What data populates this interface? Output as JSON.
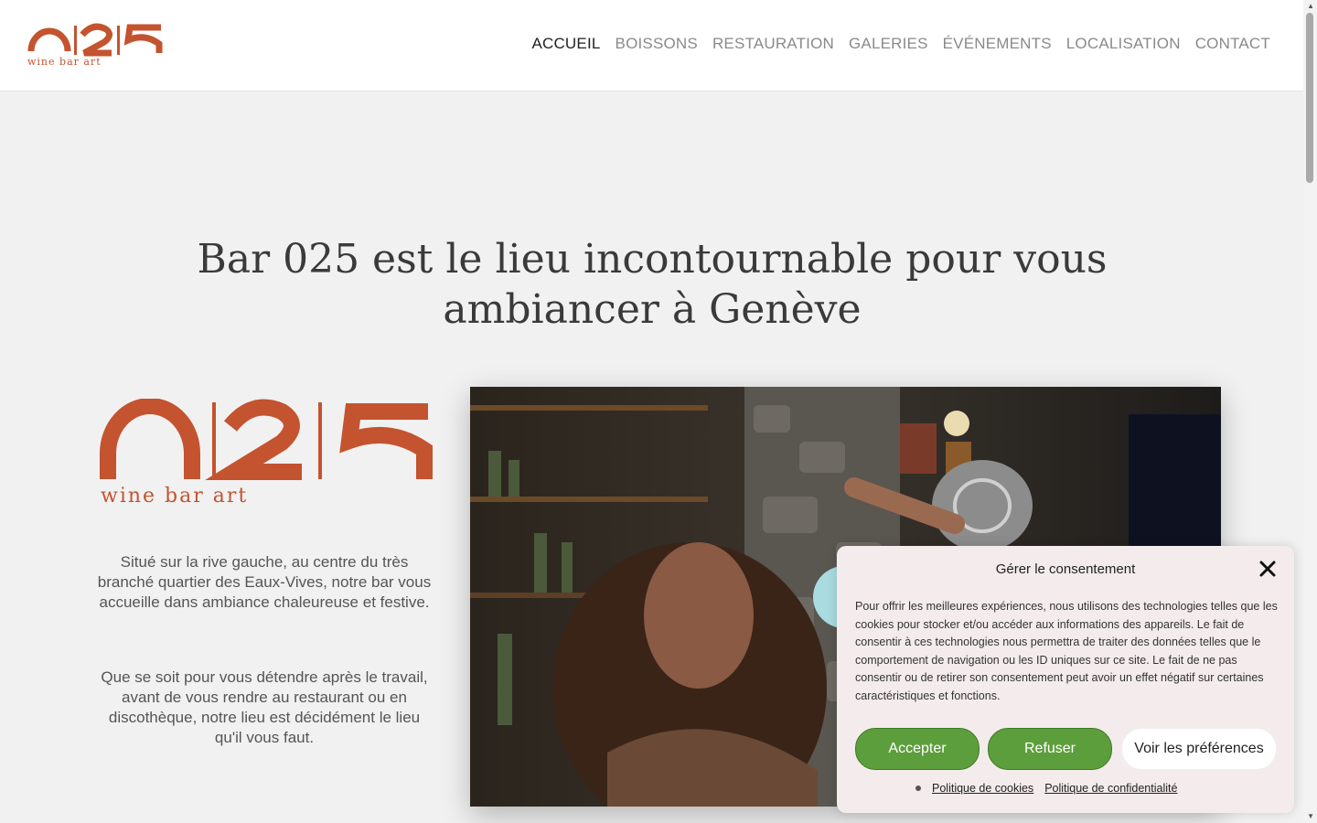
{
  "header": {
    "logo_caption": "wine bar art",
    "nav": [
      {
        "label": "ACCUEIL",
        "active": true
      },
      {
        "label": "BOISSONS"
      },
      {
        "label": "RESTAURATION"
      },
      {
        "label": "GALERIES"
      },
      {
        "label": "ÉVÉNEMENTS"
      },
      {
        "label": "LOCALISATION"
      },
      {
        "label": "CONTACT"
      }
    ]
  },
  "hero": {
    "title": "Bar 025 est le lieu incontournable pour vous ambiancer à Genève"
  },
  "intro": {
    "logo_caption": "wine bar art",
    "paragraph_1": "Situé sur la rive gauche, au centre du très branché quartier des Eaux-Vives, notre bar vous accueille dans ambiance chaleureuse et festive.",
    "paragraph_2": "Que se soit pour vous détendre après le travail, avant de vous rendre au restaurant ou en discothèque, notre lieu est décidément le lieu qu'il vous faut."
  },
  "cookie_modal": {
    "title": "Gérer le consentement",
    "text": "Pour offrir les meilleures expériences, nous utilisons des technologies telles que les cookies pour stocker et/ou accéder aux informations des appareils. Le fait de consentir à ces technologies nous permettra de traiter des données telles que le comportement de navigation ou les ID uniques sur ce site. Le fait de ne pas consentir ou de retirer son consentement peut avoir un effet négatif sur certaines caractéristiques et fonctions.",
    "accept_label": "Accepter",
    "refuse_label": "Refuser",
    "preferences_label": "Voir les préférences",
    "cookie_policy_label": "Politique de cookies",
    "privacy_policy_label": "Politique de confidentialité"
  },
  "colors": {
    "brand": "#c4532f",
    "accept_green": "#5d9e3c",
    "modal_bg": "#f4ecec"
  }
}
